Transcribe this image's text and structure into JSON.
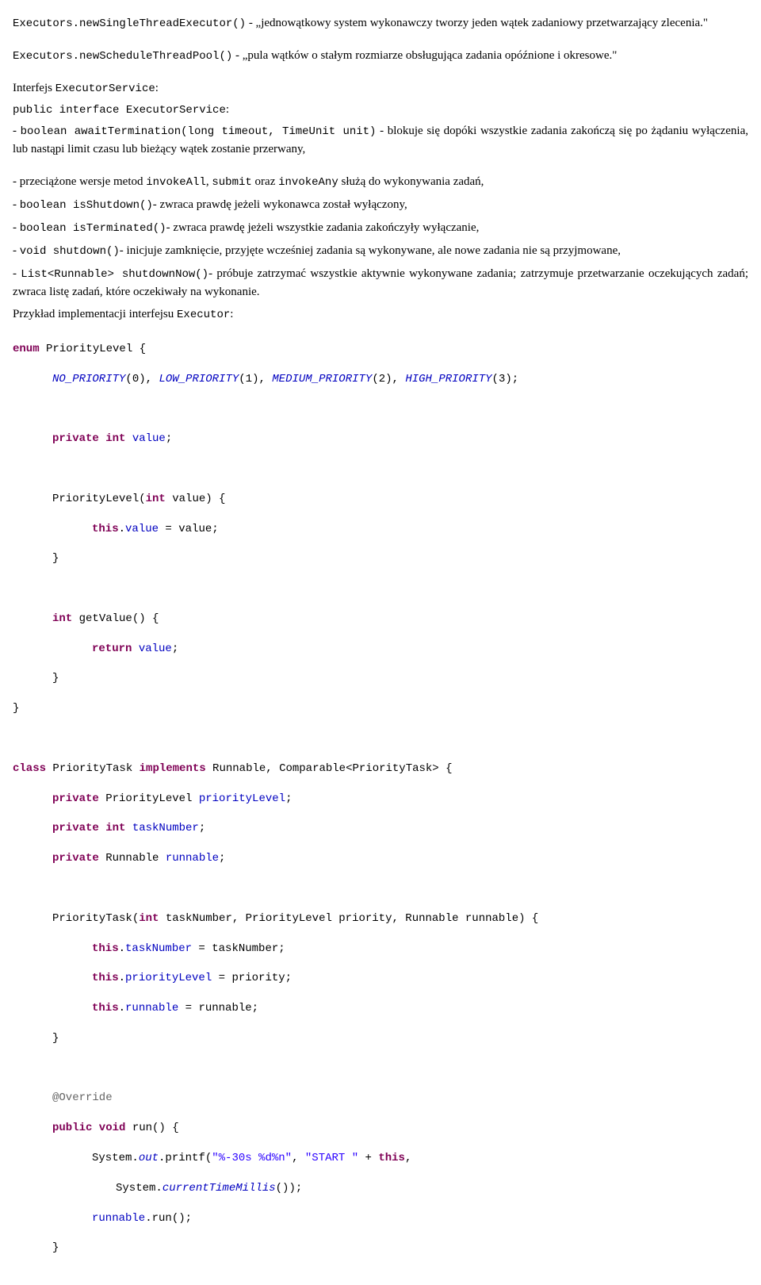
{
  "p1_code1": "Executors.newSingleThreadExecutor()",
  "p1_text1": " - „jednowątkowy system wykonawczy tworzy jeden wątek zadaniowy przetwarzający zlecenia.\"",
  "p2_code1": "Executors.newScheduleThreadPool()",
  "p2_text1": " - „pula wątków o stałym rozmiarze obsługująca zadania opóźnione i okresowe.\"",
  "p3_text1": "Interfejs ",
  "p3_code1": "ExecutorService",
  "p3_text1b": ":",
  "p3_code2": "public interface ExecutorService",
  "p3_text2": "- ",
  "p3_code3": "boolean awaitTermination(long timeout, TimeUnit unit)",
  "p3_text3": " - blokuje się dopóki wszystkie zadania zakończą się po żądaniu wyłączenia, lub nastąpi limit czasu lub bieżący wątek zostanie przerwany,",
  "p4_text1": "- przeciążone wersje metod ",
  "p4_code1": "invokeAll",
  "p4_text2": ", ",
  "p4_code2": "submit",
  "p4_text3": " oraz ",
  "p4_code3": "invokeAny",
  "p4_text4": " służą do wykonywania zadań,",
  "p5_text1": "- ",
  "p5_code1": "boolean isShutdown()",
  "p5_text2": "- zwraca prawdę jeżeli wykonawca został wyłączony,",
  "p6_text1": "- ",
  "p6_code1": "boolean isTerminated()",
  "p6_text2": "- zwraca prawdę jeżeli wszystkie zadania zakończyły wyłączanie,",
  "p7_text1": "- ",
  "p7_code1": "void shutdown()",
  "p7_text2": "- inicjuje zamknięcie, przyjęte wcześniej zadania są wykonywane, ale nowe zadania nie są przyjmowane,",
  "p8_text1": "- ",
  "p8_code1": "List<Runnable> shutdownNow()",
  "p8_text2": "- próbuje zatrzymać wszystkie aktywnie wykonywane zadania; zatrzymuje przetwarzanie oczekujących zadań; zwraca listę zadań, które oczekiwały na wykonanie.",
  "p9_text1": "Przykład implementacji interfejsu ",
  "p9_code1": "Executor",
  "p9_text2": ":",
  "c_l1_kw1": "enum",
  "c_l1_t1": " PriorityLevel {",
  "c_l2_a": "NO_PRIORITY",
  "c_l2_b": "(0), ",
  "c_l2_c": "LOW_PRIORITY",
  "c_l2_d": "(1), ",
  "c_l2_e": "MEDIUM_PRIORITY",
  "c_l2_f": "(2), ",
  "c_l2_g": "HIGH_PRIORITY",
  "c_l2_h": "(3);",
  "c_l3_kw1": "private int",
  "c_l3_f": " value",
  "c_l3_t": ";",
  "c_l4_t1": "PriorityLevel(",
  "c_l4_kw1": "int",
  "c_l4_t2": " value) {",
  "c_l5_kw1": "this",
  "c_l5_t1": ".",
  "c_l5_f1": "value",
  "c_l5_t2": " = value;",
  "c_l6": "}",
  "c_l7_kw1": "int",
  "c_l7_t1": " getValue() {",
  "c_l8_kw1": "return",
  "c_l8_f1": " value",
  "c_l8_t1": ";",
  "c_l9": "}",
  "c_l10": "}",
  "c_l11_kw1": "class",
  "c_l11_t1": " PriorityTask ",
  "c_l11_kw2": "implements",
  "c_l11_t2": " Runnable, Comparable<PriorityTask> {",
  "c_l12_kw1": "private",
  "c_l12_t1": " PriorityLevel ",
  "c_l12_f1": "priorityLevel",
  "c_l12_t2": ";",
  "c_l13_kw1": "private int",
  "c_l13_f1": " taskNumber",
  "c_l13_t1": ";",
  "c_l14_kw1": "private",
  "c_l14_t1": " Runnable ",
  "c_l14_f1": "runnable",
  "c_l14_t2": ";",
  "c_l15_t1": "PriorityTask(",
  "c_l15_kw1": "int",
  "c_l15_t2": " taskNumber, PriorityLevel priority, Runnable runnable) {",
  "c_l16_kw1": "this",
  "c_l16_t1": ".",
  "c_l16_f1": "taskNumber",
  "c_l16_t2": " = taskNumber;",
  "c_l17_kw1": "this",
  "c_l17_t1": ".",
  "c_l17_f1": "priorityLevel",
  "c_l17_t2": " = priority;",
  "c_l18_kw1": "this",
  "c_l18_t1": ".",
  "c_l18_f1": "runnable",
  "c_l18_t2": " = runnable;",
  "c_l19": "}",
  "c_l20": "@Override",
  "c_l21_kw1": "public void",
  "c_l21_t1": " run() {",
  "c_l22_t1": "System.",
  "c_l22_s1": "out",
  "c_l22_t2": ".printf(",
  "c_l22_str1": "\"%-30s %d%n\"",
  "c_l22_t3": ", ",
  "c_l22_str2": "\"START \"",
  "c_l22_t4": " + ",
  "c_l22_kw1": "this",
  "c_l22_t5": ",",
  "c_l23_t1": "System.",
  "c_l23_m1": "currentTimeMillis",
  "c_l23_t2": "());",
  "c_l24_f1": "runnable",
  "c_l24_t1": ".run();",
  "c_l25": "}"
}
